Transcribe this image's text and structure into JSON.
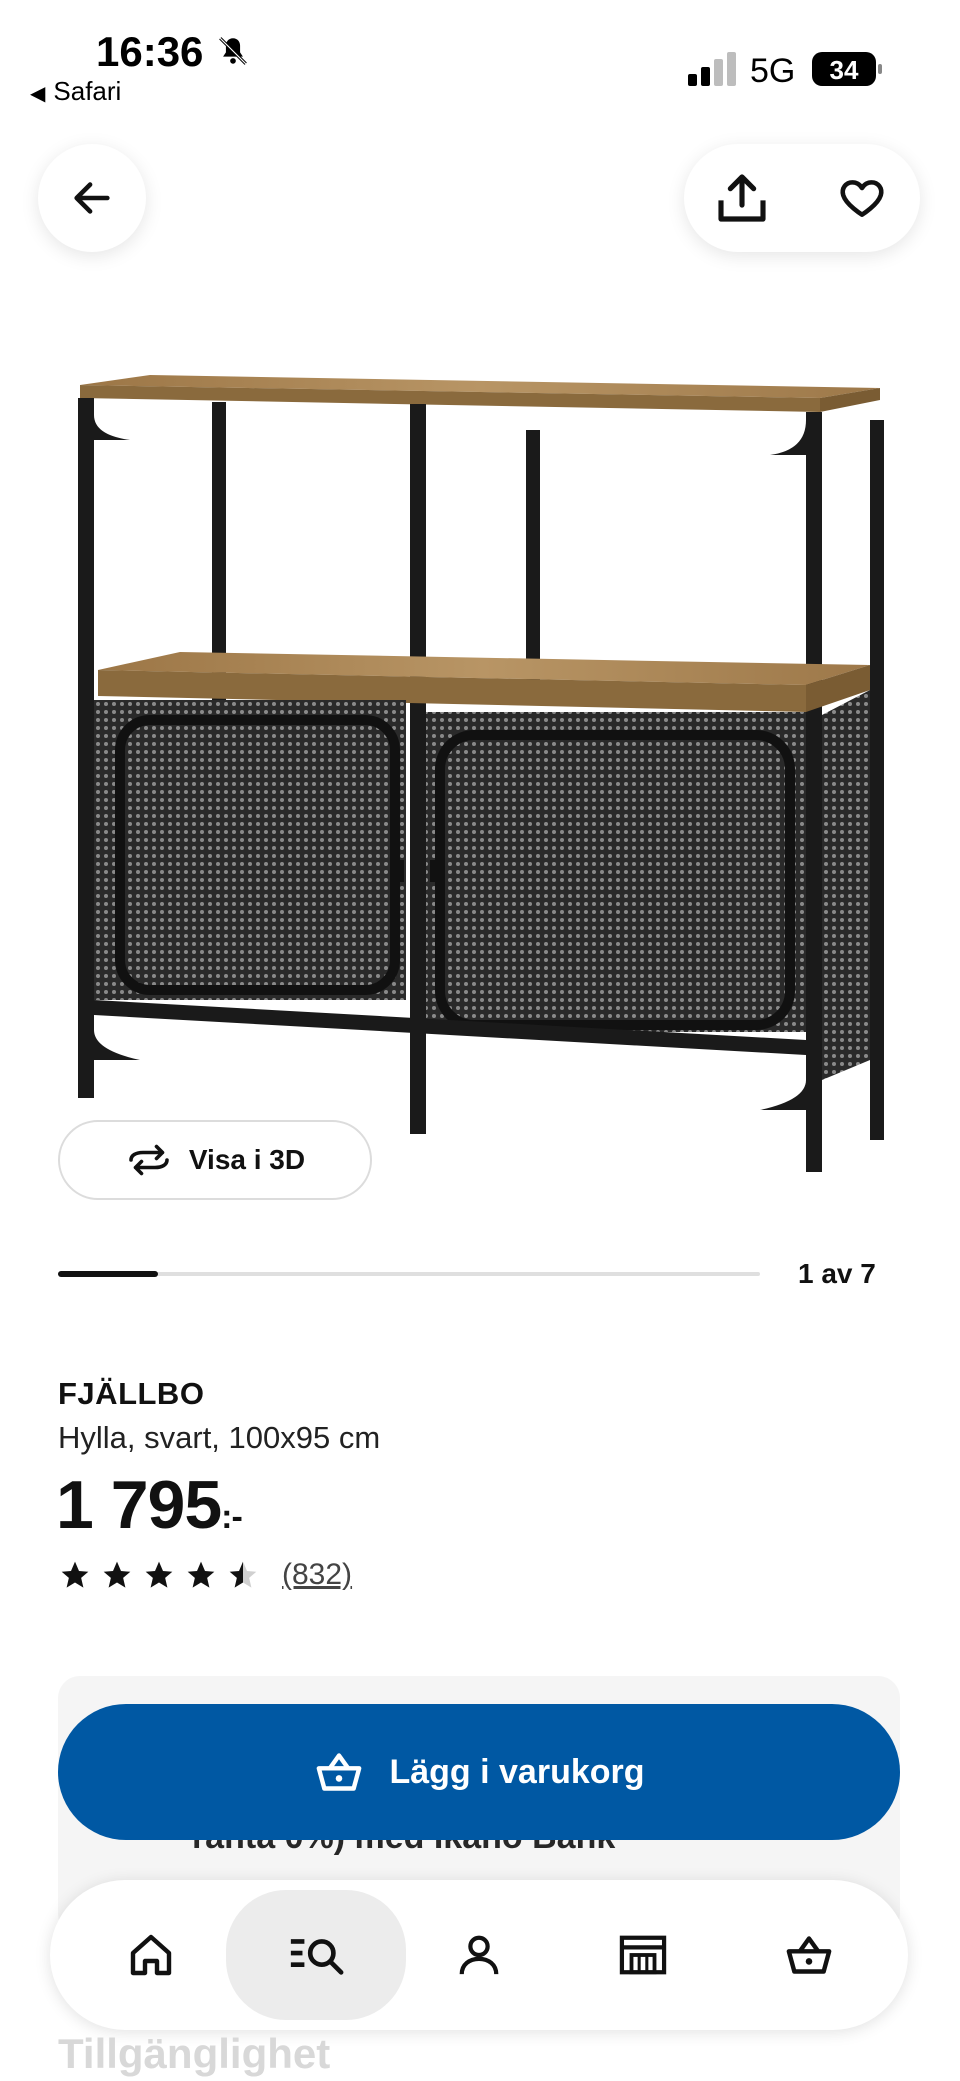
{
  "status_bar": {
    "time": "16:36",
    "back_app": "Safari",
    "network": "5G",
    "battery": "34"
  },
  "product": {
    "brand": "FJÄLLBO",
    "description": "Hylla, svart, 100x95 cm",
    "price": "1 795",
    "price_suffix": ":-",
    "rating": 4.5,
    "reviews": "(832)"
  },
  "gallery": {
    "view3d_label": "Visa i 3D",
    "counter": "1 av 7",
    "current": 1,
    "total": 7
  },
  "actions": {
    "add_to_cart": "Lägg i varukorg",
    "partial_text": "ränta 0%) med Ikano Bank"
  },
  "footer": {
    "partial_heading": "Tillgänglighet"
  },
  "bottom_nav": {
    "items": [
      "home-icon",
      "search-icon",
      "profile-icon",
      "store-icon",
      "cart-icon"
    ],
    "active": "search-icon"
  },
  "colors": {
    "primary": "#0058a3",
    "text": "#111111",
    "wood": "#b08a57"
  }
}
